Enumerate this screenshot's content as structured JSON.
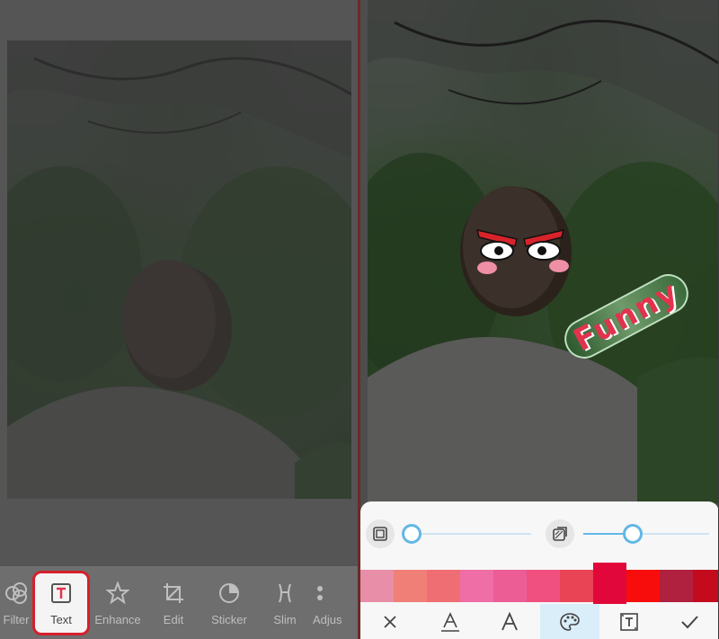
{
  "left_screen": {
    "toolbar": [
      {
        "label": "Filter",
        "icon": "filter-icon"
      },
      {
        "label": "Text",
        "icon": "text-icon",
        "selected": true
      },
      {
        "label": "Enhance",
        "icon": "star-icon"
      },
      {
        "label": "Edit",
        "icon": "crop-icon"
      },
      {
        "label": "Sticker",
        "icon": "sticker-icon"
      },
      {
        "label": "Slim",
        "icon": "slim-icon"
      },
      {
        "label": "Adjus",
        "icon": "adjust-icon"
      }
    ]
  },
  "right_screen": {
    "sticker_text": "Funny",
    "opacity_slider": {
      "value": 0.0
    },
    "shadow_slider": {
      "value": 0.4
    },
    "swatches": [
      "#e88ea8",
      "#f07f78",
      "#ef6e73",
      "#ee6ea5",
      "#ec5d95",
      "#f0507f",
      "#e84455",
      "#e2073a",
      "#f80d0d",
      "#b0203f",
      "#c40b1e"
    ],
    "selected_swatch": 7,
    "actions": [
      {
        "name": "close-icon",
        "symbol": "✕"
      },
      {
        "name": "font-style-icon",
        "symbol": "A"
      },
      {
        "name": "font-icon",
        "symbol": "A"
      },
      {
        "name": "palette-icon",
        "symbol": "🎨",
        "active": true
      },
      {
        "name": "text-box-icon",
        "symbol": "T"
      },
      {
        "name": "check-icon",
        "symbol": "✓"
      }
    ],
    "colors": {
      "accent": "#62b7e6",
      "selection": "#d6202c",
      "text_red": "#e2334d"
    }
  }
}
